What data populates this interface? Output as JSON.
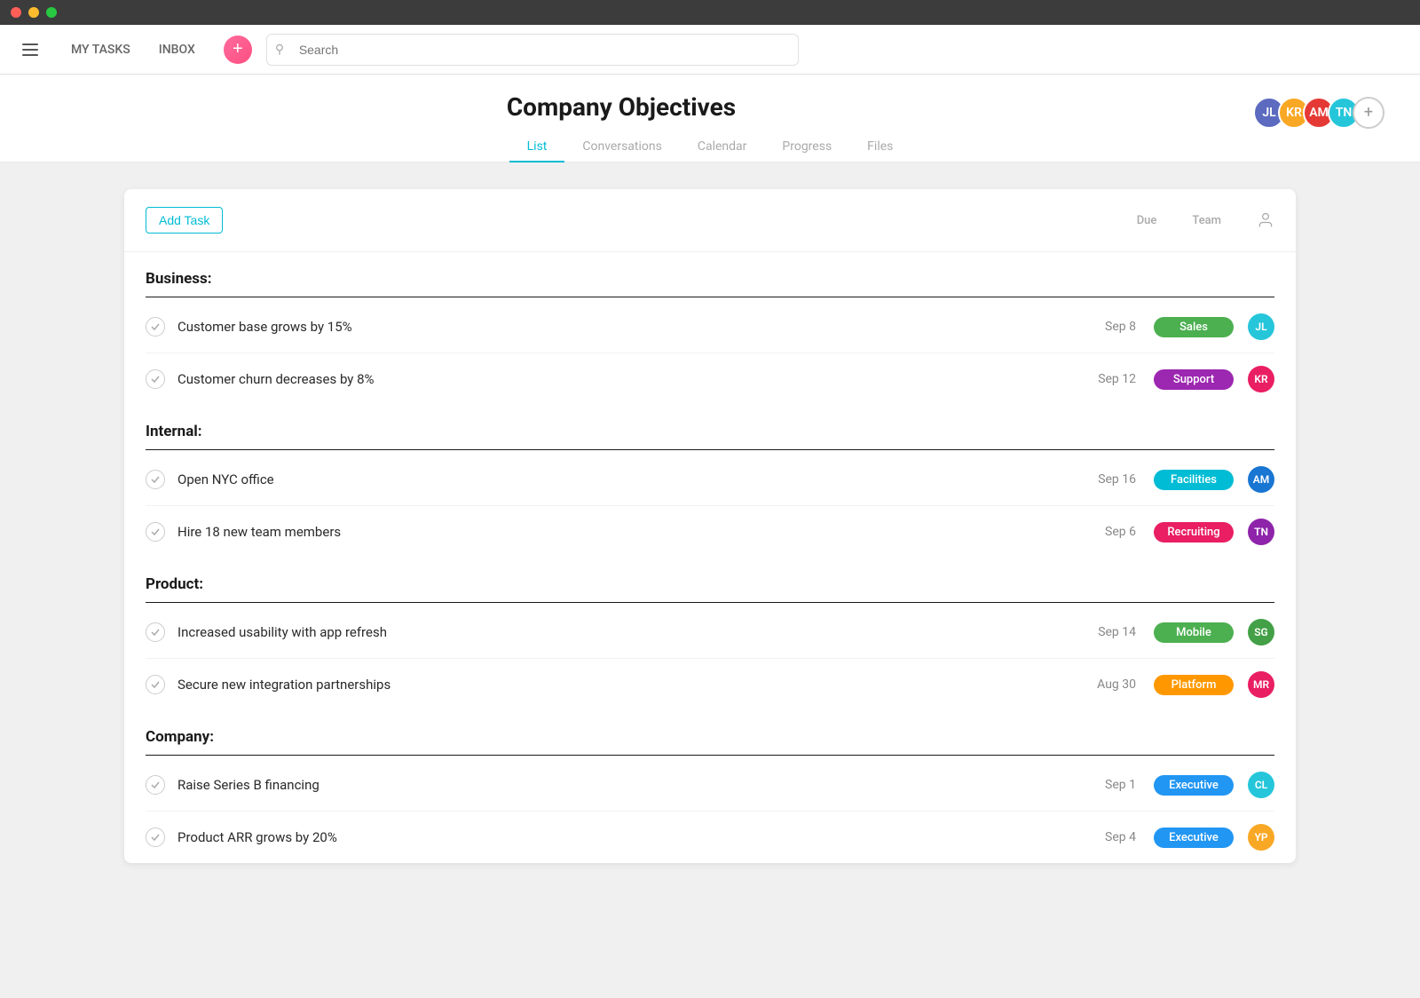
{
  "titlebar": {
    "lights": [
      "red",
      "yellow",
      "green"
    ]
  },
  "topnav": {
    "my_tasks": "MY TASKS",
    "inbox": "INBOX",
    "search_placeholder": "Search"
  },
  "page": {
    "title": "Company Objectives",
    "tabs": [
      {
        "label": "List",
        "active": true
      },
      {
        "label": "Conversations",
        "active": false
      },
      {
        "label": "Calendar",
        "active": false
      },
      {
        "label": "Progress",
        "active": false
      },
      {
        "label": "Files",
        "active": false
      }
    ]
  },
  "card": {
    "add_task_label": "Add Task",
    "col_due": "Due",
    "col_team": "Team"
  },
  "sections": [
    {
      "title": "Business:",
      "tasks": [
        {
          "name": "Customer base grows by 15%",
          "due": "Sep 8",
          "team": "Sales",
          "badge_class": "badge-sales",
          "avatar_initials": "JL",
          "avatar_class": "av-teal"
        },
        {
          "name": "Customer churn decreases by 8%",
          "due": "Sep 12",
          "team": "Support",
          "badge_class": "badge-support",
          "avatar_initials": "KR",
          "avatar_class": "av-pink"
        }
      ]
    },
    {
      "title": "Internal:",
      "tasks": [
        {
          "name": "Open NYC office",
          "due": "Sep 16",
          "team": "Facilities",
          "badge_class": "badge-facilities",
          "avatar_initials": "AM",
          "avatar_class": "av-blue"
        },
        {
          "name": "Hire 18 new team members",
          "due": "Sep 6",
          "team": "Recruiting",
          "badge_class": "badge-recruiting",
          "avatar_initials": "TN",
          "avatar_class": "av-purple"
        }
      ]
    },
    {
      "title": "Product:",
      "tasks": [
        {
          "name": "Increased usability with app refresh",
          "due": "Sep 14",
          "team": "Mobile",
          "badge_class": "badge-mobile",
          "avatar_initials": "SG",
          "avatar_class": "av-green"
        },
        {
          "name": "Secure new integration partnerships",
          "due": "Aug 30",
          "team": "Platform",
          "badge_class": "badge-platform",
          "avatar_initials": "MR",
          "avatar_class": "av-pink"
        }
      ]
    },
    {
      "title": "Company:",
      "tasks": [
        {
          "name": "Raise Series B financing",
          "due": "Sep 1",
          "team": "Executive",
          "badge_class": "badge-executive",
          "avatar_initials": "CL",
          "avatar_class": "av-teal"
        },
        {
          "name": "Product ARR grows by 20%",
          "due": "Sep 4",
          "team": "Executive",
          "badge_class": "badge-executive",
          "avatar_initials": "YP",
          "avatar_class": "av-yellow"
        }
      ]
    }
  ],
  "team_members": [
    {
      "initials": "JL",
      "color": "#5c6bc0"
    },
    {
      "initials": "KR",
      "color": "#f9a825"
    },
    {
      "initials": "AM",
      "color": "#e53935"
    },
    {
      "initials": "TN",
      "color": "#26c6da"
    }
  ]
}
